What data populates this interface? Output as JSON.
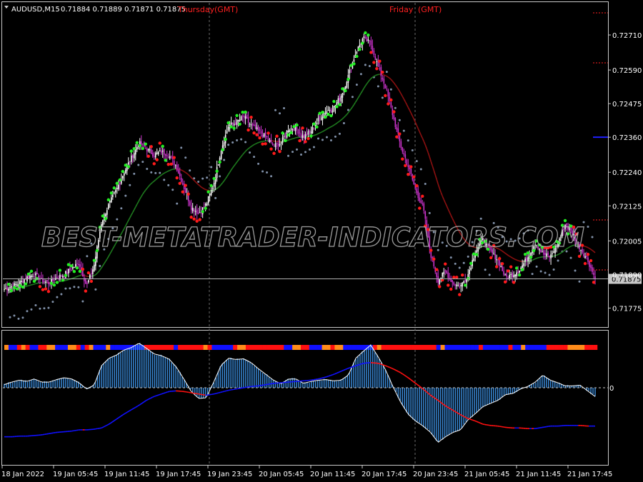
{
  "header": {
    "symbol": "AUDUSD,M15",
    "ohlc": "0.71884 0.71889 0.71871 0.71875"
  },
  "sessions": [
    {
      "label": "Thursday",
      "tz": "(GMT)",
      "x_time": "19 Jan 23:45"
    },
    {
      "label": "Friday",
      "tz": "(GMT)",
      "x_time": "21 Jan 00:00"
    }
  ],
  "watermark": "BEST-METATRADER-INDICATORS.COM",
  "colors": {
    "background": "#000000",
    "bull": "#ffffff",
    "bear": "#cc33cc",
    "signal_bull": "#22ee22",
    "signal_bear": "#ff1a1a",
    "band": "#8090a8",
    "ma_up": "#1e7a1e",
    "ma_down": "#8b1010",
    "hist": "#3a8ad8",
    "level_blue": "#2020ff",
    "strip_blue": "#1010ff",
    "strip_orange": "#ff8c1a",
    "strip_red": "#ff1010"
  },
  "chart_data": [
    {
      "type": "candlestick",
      "panel": "price",
      "y_ticks": [
        "0.72710",
        "0.72590",
        "0.72475",
        "0.72360",
        "0.72240",
        "0.72125",
        "0.72005",
        "0.71890",
        "0.71775"
      ],
      "ylim": [
        0.7171,
        0.7282
      ],
      "current_price": "0.71875",
      "blue_level": 0.7236,
      "x_tick_labels": [
        "18 Jan 2022",
        "19 Jan 05:45",
        "19 Jan 11:45",
        "19 Jan 17:45",
        "19 Jan 23:45",
        "20 Jan 05:45",
        "20 Jan 11:45",
        "20 Jan 17:45",
        "20 Jan 23:45",
        "21 Jan 05:45",
        "21 Jan 11:45",
        "21 Jan 17:45"
      ],
      "close_path": [
        0.7184,
        0.7185,
        0.7186,
        0.7188,
        0.7189,
        0.7187,
        0.7186,
        0.7188,
        0.7189,
        0.7191,
        0.7193,
        0.7185,
        0.7192,
        0.7207,
        0.7213,
        0.7218,
        0.7224,
        0.7229,
        0.7234,
        0.7232,
        0.723,
        0.7231,
        0.723,
        0.7226,
        0.7219,
        0.7212,
        0.721,
        0.7213,
        0.722,
        0.7232,
        0.724,
        0.7241,
        0.7243,
        0.724,
        0.7238,
        0.7236,
        0.7233,
        0.7234,
        0.7239,
        0.7239,
        0.7236,
        0.7238,
        0.7242,
        0.7245,
        0.7246,
        0.725,
        0.7257,
        0.7265,
        0.727,
        0.7268,
        0.726,
        0.7253,
        0.7243,
        0.7233,
        0.7226,
        0.7218,
        0.7212,
        0.7196,
        0.7187,
        0.719,
        0.7186,
        0.7185,
        0.7189,
        0.7197,
        0.7201,
        0.7197,
        0.7194,
        0.7188,
        0.7189,
        0.7191,
        0.7195,
        0.72,
        0.7196,
        0.7195,
        0.72,
        0.7206,
        0.7203,
        0.7198,
        0.7194,
        0.71875
      ]
    },
    {
      "type": "histogram",
      "panel": "oscillator",
      "zero_label": "0",
      "values": [
        0.05,
        0.09,
        0.12,
        0.1,
        0.14,
        0.09,
        0.09,
        0.13,
        0.16,
        0.14,
        0.08,
        -0.02,
        0.04,
        0.35,
        0.47,
        0.52,
        0.6,
        0.64,
        0.71,
        0.63,
        0.54,
        0.51,
        0.46,
        0.33,
        0.14,
        -0.06,
        -0.17,
        -0.16,
        0.09,
        0.36,
        0.47,
        0.45,
        0.46,
        0.4,
        0.3,
        0.21,
        0.12,
        0.06,
        0.14,
        0.14,
        0.07,
        0.1,
        0.12,
        0.13,
        0.11,
        0.12,
        0.2,
        0.47,
        0.58,
        0.68,
        0.49,
        0.28,
        0.01,
        -0.23,
        -0.42,
        -0.53,
        -0.61,
        -0.71,
        -0.87,
        -0.78,
        -0.71,
        -0.67,
        -0.51,
        -0.41,
        -0.3,
        -0.25,
        -0.2,
        -0.11,
        -0.09,
        -0.02,
        0.02,
        0.09,
        0.2,
        0.12,
        0.08,
        0.03,
        0.03,
        0.04,
        -0.05,
        -0.14
      ],
      "slow_line": [
        -0.78,
        -0.78,
        -0.77,
        -0.77,
        -0.76,
        -0.75,
        -0.73,
        -0.71,
        -0.7,
        -0.69,
        -0.67,
        -0.67,
        -0.66,
        -0.64,
        -0.58,
        -0.5,
        -0.42,
        -0.35,
        -0.28,
        -0.2,
        -0.14,
        -0.1,
        -0.06,
        -0.05,
        -0.06,
        -0.08,
        -0.1,
        -0.12,
        -0.1,
        -0.07,
        -0.04,
        -0.02,
        0.0,
        0.02,
        0.03,
        0.05,
        0.07,
        0.08,
        0.09,
        0.1,
        0.11,
        0.12,
        0.14,
        0.17,
        0.21,
        0.26,
        0.31,
        0.35,
        0.39,
        0.4,
        0.39,
        0.35,
        0.3,
        0.24,
        0.16,
        0.07,
        -0.02,
        -0.12,
        -0.2,
        -0.29,
        -0.36,
        -0.43,
        -0.49,
        -0.53,
        -0.58,
        -0.6,
        -0.61,
        -0.63,
        -0.64,
        -0.64,
        -0.65,
        -0.65,
        -0.63,
        -0.61,
        -0.61,
        -0.6,
        -0.6,
        -0.6,
        -0.61,
        -0.61
      ]
    }
  ]
}
